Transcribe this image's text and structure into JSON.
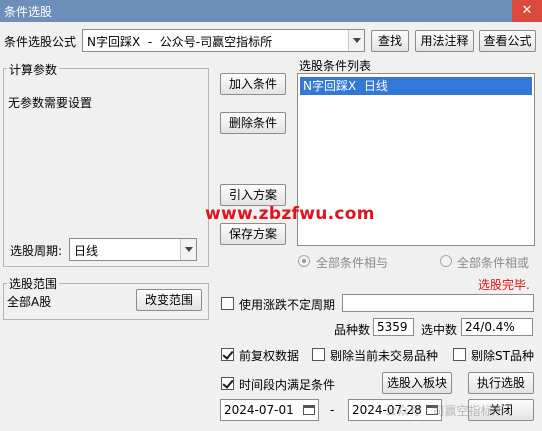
{
  "window": {
    "title": "条件选股",
    "close_icon": "close-x"
  },
  "formula": {
    "label": "条件选股公式",
    "value": "N字回踩X  -  公众号-司赢空指标所"
  },
  "top_buttons": {
    "find": "查找",
    "usage": "用法注释",
    "view": "查看公式"
  },
  "params": {
    "legend": "计算参数",
    "text": "无参数需要设置",
    "period_label": "选股周期:",
    "period_value": "日线"
  },
  "actions": {
    "add": "加入条件",
    "delete": "删除条件",
    "import": "引入方案",
    "save": "保存方案"
  },
  "condition_list": {
    "legend": "选股条件列表",
    "items": [
      "N字回踩X  日线"
    ]
  },
  "watermark": "www.zbzfwu.com",
  "logic": {
    "and_label": "全部条件相与",
    "or_label": "全部条件相或",
    "selected": "and"
  },
  "status": {
    "text": "选股完毕.",
    "color": "#e01010"
  },
  "range": {
    "legend": "选股范围",
    "value": "全部A股",
    "change_button": "改变范围"
  },
  "limit_period": {
    "label": "使用涨跌不定周期",
    "value": ""
  },
  "stats": {
    "count_label": "品种数",
    "count_value": "5359",
    "selected_label": "选中数",
    "selected_value": "24/0.4%"
  },
  "options": {
    "adjusted": "前复权数据",
    "exclude_untraded": "剔除当前未交易品种",
    "exclude_st": "剔除ST品种",
    "time_range": "时间段内满足条件"
  },
  "bottom_buttons": {
    "to_block": "选股入板块",
    "execute": "执行选股",
    "close": "关闭"
  },
  "dates": {
    "start": "2024-07-01",
    "separator": "-",
    "end": "2024-07-28"
  },
  "footer_watermark": "公众号 · 司赢空指标所"
}
